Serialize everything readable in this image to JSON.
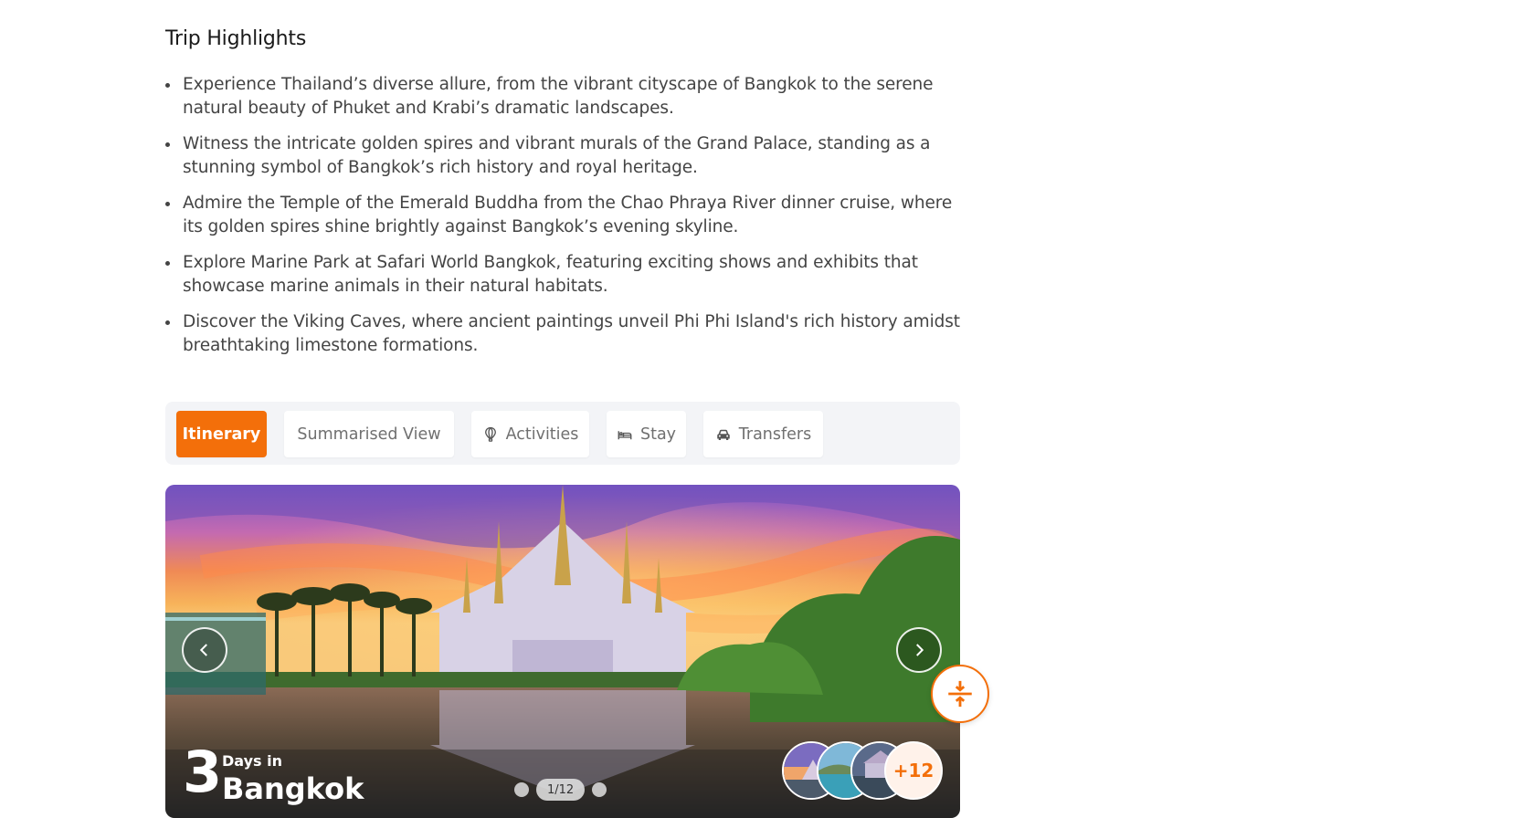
{
  "highlights": {
    "title": "Trip Highlights",
    "items": [
      "Experience Thailand’s diverse allure, from the vibrant cityscape of Bangkok to the serene natural beauty of Phuket and Krabi’s dramatic landscapes.",
      "Witness the intricate golden spires and vibrant murals of the Grand Palace, standing as a stunning symbol of Bangkok’s rich history and royal heritage.",
      "Admire the Temple of the Emerald Buddha from the Chao Phraya River dinner cruise, where its golden spires shine brightly against Bangkok’s evening skyline.",
      "Explore Marine Park at Safari World Bangkok, featuring exciting shows and exhibits that showcase marine animals in their natural habitats.",
      "Discover the Viking Caves, where ancient paintings unveil Phi Phi Island's rich history amidst breathtaking limestone formations."
    ]
  },
  "tabs": [
    {
      "label": "Itinerary",
      "icon": "none",
      "active": true
    },
    {
      "label": "Summarised View",
      "icon": "none",
      "active": false
    },
    {
      "label": "Activities",
      "icon": "hot-air-balloon-icon",
      "active": false
    },
    {
      "label": "Stay",
      "icon": "bed-icon",
      "active": false
    },
    {
      "label": "Transfers",
      "icon": "car-icon",
      "active": false
    }
  ],
  "hero": {
    "day_count": "3",
    "day_prefix": "Days in",
    "city": "Bangkok",
    "pager": "1/12",
    "more_photos": "+12"
  },
  "colors": {
    "accent": "#f36f0a",
    "tab_bar_bg": "#f3f4f7",
    "text": "#444444"
  }
}
